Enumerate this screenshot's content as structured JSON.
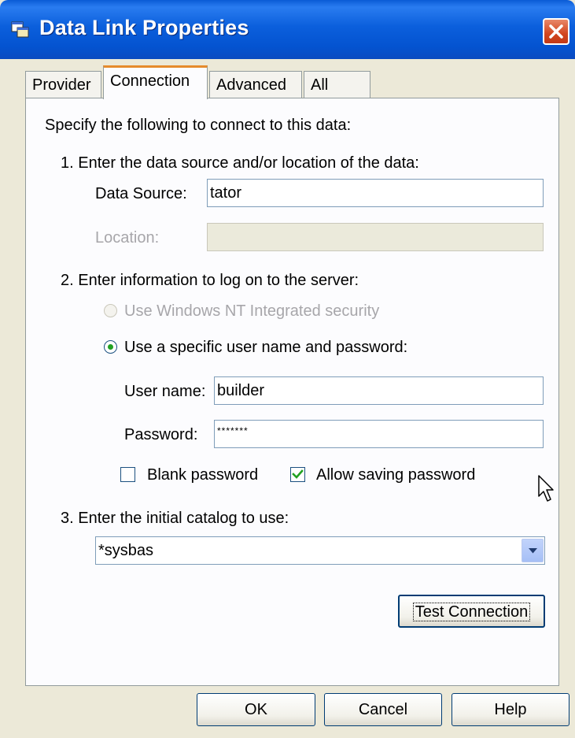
{
  "window": {
    "title": "Data Link Properties"
  },
  "tabs": [
    {
      "label": "Provider"
    },
    {
      "label": "Connection"
    },
    {
      "label": "Advanced"
    },
    {
      "label": "All"
    }
  ],
  "connection": {
    "intro": "Specify the following to connect to this data:",
    "step1": {
      "heading": "1. Enter the data source and/or location of the data:",
      "data_source_label": "Data Source:",
      "data_source_value": "tator",
      "location_label": "Location:",
      "location_value": ""
    },
    "step2": {
      "heading": "2. Enter information to log on to the server:",
      "option_nt": "Use Windows NT Integrated security",
      "option_specific": "Use a specific user name and password:",
      "selected_option": "specific",
      "user_name_label": "User name:",
      "user_name_value": "builder",
      "password_label": "Password:",
      "password_value": "*******",
      "blank_password_label": "Blank password",
      "blank_password_checked": false,
      "allow_saving_label": "Allow saving password",
      "allow_saving_checked": true
    },
    "step3": {
      "heading": "3. Enter the initial catalog to use:",
      "catalog_value": "*sysbas"
    },
    "test_connection_label": "Test Connection"
  },
  "footer": {
    "ok_label": "OK",
    "cancel_label": "Cancel",
    "help_label": "Help"
  },
  "colors": {
    "title_bar": "#0b5fdc",
    "dialog_bg": "#ece9d8",
    "active_tab_accent": "#e68b2c",
    "close_button": "#d2451e"
  },
  "icons": [
    "data-link-app-icon",
    "close-icon",
    "chevron-down-icon",
    "checkmark-icon",
    "mouse-pointer-icon"
  ]
}
